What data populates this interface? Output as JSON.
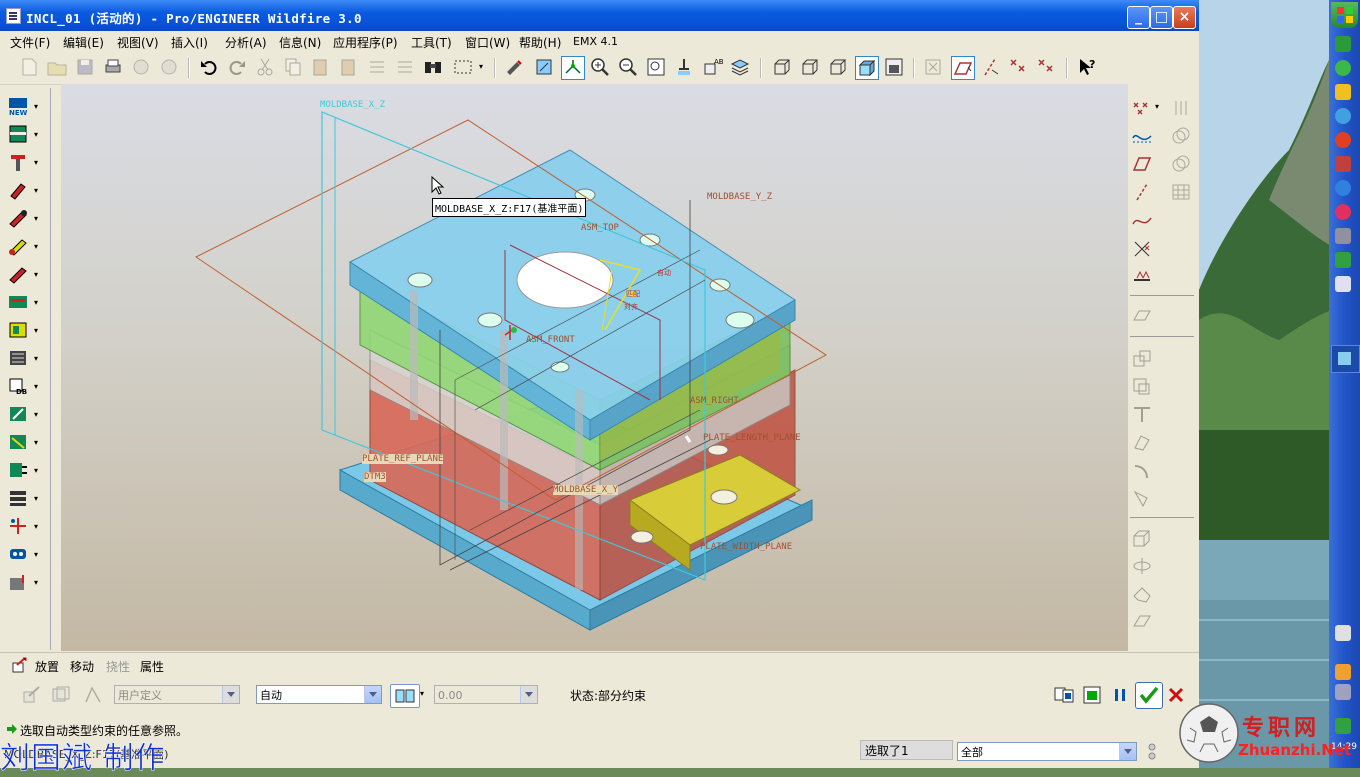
{
  "window": {
    "title": "INCL_01 (活动的) - Pro/ENGINEER Wildfire 3.0",
    "minimize": "_",
    "maximize": "□",
    "close": "×"
  },
  "menu": [
    "文件(F)",
    "编辑(E)",
    "视图(V)",
    "插入(I)",
    "分析(A)",
    "信息(N)",
    "应用程序(P)",
    "工具(T)",
    "窗口(W)",
    "帮助(H)",
    "EMX 4.1"
  ],
  "viewport": {
    "tooltip": "MOLDBASE_X_Z:F17(基准平面)",
    "labels": {
      "moldbase_x_z": "MOLDBASE_X_Z",
      "moldbase_y_z": "MOLDBASE_Y_Z",
      "asm_top": "ASM_TOP",
      "asm_front": "ASM_FRONT",
      "asm_right": "ASM_RIGHT",
      "plate_length_plane": "PLATE_LENGTH_PLANE",
      "plate_ref_plane": "PLATE_REF_PLANE",
      "dtm3": "DTM3",
      "moldbase_x_y": "MOLDBASE_X_Y",
      "plate_width_plane": "PLATE_WIDTH_PLANE",
      "auto1": "自动",
      "auto2": "匹配",
      "auto3": "对齐"
    }
  },
  "dashboard": {
    "tabs": [
      "放置",
      "移动",
      "挠性",
      "属性"
    ],
    "constraint_set": "用户定义",
    "constraint_type": "自动",
    "offset_value": "0.00",
    "status": "状态:部分约束"
  },
  "statusbar": {
    "message": "选取自动类型约束的任意参照。",
    "bottom_text": "MOLDBASE_X_Z:F17(基准平面)",
    "selected": "选取了1",
    "filter": "全部"
  },
  "watermark": {
    "author": "刘国斌 制作",
    "site_cn": "专职网",
    "site_en": "Zhuanzhi.Net"
  },
  "tray_clock": "14:29",
  "colors": {
    "title_blue": "#0a5be0",
    "accent_green": "#1a9a1a",
    "cancel_red": "#cc1010"
  }
}
